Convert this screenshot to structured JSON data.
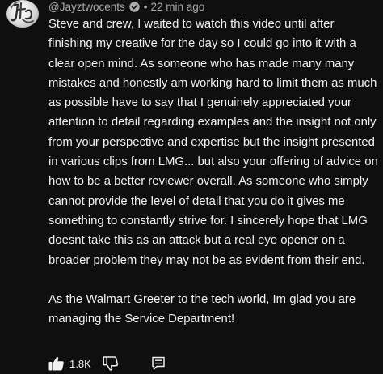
{
  "comment": {
    "author": "@Jayztwocents",
    "verified_icon": "verified-check-icon",
    "separator": "•",
    "timestamp": "22 min ago",
    "paragraphs": [
      "Steve and crew, I waited to watch this video until after finishing my creative for the day so I could go into it with a clear open mind. As someone who has made many many mistakes and honestly am working hard to limit them as much as possible have to say that I genuinely appreciated your attention to detail regarding examples and the insight not only from your perspective and expertise but the insight presented in various clips from LMG... but also your offering of advice on how to be a better reviewer overall. As someone who simply cannot provide the level of detail that you do it gives me something to constantly strive for. I sincerely hope that LMG doesnt take this as an attack but a real eye opener on a broader problem they may not be as evident from their end.",
      "As the Walmart Greeter to the tech world, Im glad you are managing the Service Department!"
    ],
    "like_count": "1.8K",
    "like_icon": "thumbs-up-filled-icon",
    "dislike_icon": "thumbs-down-icon",
    "reply_icon": "comment-reply-icon"
  },
  "colors": {
    "background": "#0f0f0f",
    "text_primary": "#f1f1f1",
    "text_secondary": "#aaaaaa"
  }
}
